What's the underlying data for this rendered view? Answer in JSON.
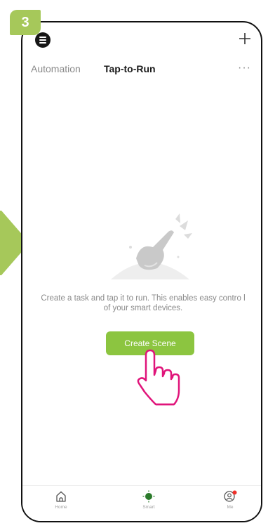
{
  "step": {
    "number": "3",
    "color": "#a6c85a"
  },
  "header": {
    "icons": {
      "logo": "app-logo-icon",
      "add": "plus-icon"
    }
  },
  "tabs": [
    {
      "label": "Automation",
      "active": false
    },
    {
      "label": "Tap-to-Run",
      "active": true
    }
  ],
  "more_label": "···",
  "empty_state": {
    "illustration": "tap-hand-illustration",
    "text": "Create a task and tap it to run. This enables easy contro l of your smart devices.",
    "button_label": "Create Scene",
    "button_color": "#8cc540"
  },
  "annotation": {
    "icon": "hand-pointer-icon",
    "color": "#e0147a"
  },
  "bottom_nav": [
    {
      "label": "Home",
      "icon": "home-icon"
    },
    {
      "label": "Smart",
      "icon": "smart-icon",
      "active": true
    },
    {
      "label": "Me",
      "icon": "profile-icon",
      "badge": true
    }
  ]
}
